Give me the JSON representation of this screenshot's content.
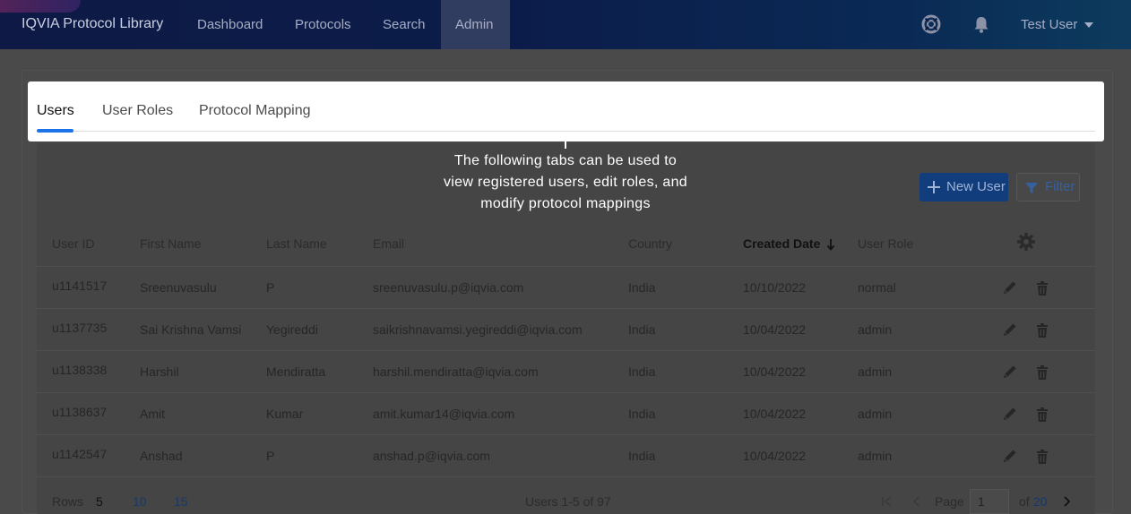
{
  "app": {
    "title": "IQVIA Protocol Library"
  },
  "nav": {
    "items": [
      "Dashboard",
      "Protocols",
      "Search",
      "Admin"
    ],
    "active": "Admin"
  },
  "header": {
    "help_icon": "life-ring-icon",
    "notifications_icon": "bell-icon",
    "user_name": "Test User"
  },
  "tabs": {
    "items": [
      "Users",
      "User Roles",
      "Protocol Mapping"
    ],
    "active": "Users"
  },
  "tooltip": {
    "text": "The following tabs can be used to view registered users, edit roles, and modify protocol mappings"
  },
  "toolbar": {
    "new_user_label": "New User",
    "filter_label": "Filter"
  },
  "table": {
    "columns": [
      "User ID",
      "First Name",
      "Last Name",
      "Email",
      "Country",
      "Created Date",
      "User Role"
    ],
    "sorted_column": "Created Date",
    "sort_direction": "descending",
    "rows": [
      {
        "user_id": "u1141517",
        "first_name": "Sreenuvasulu",
        "last_name": "P",
        "email": "sreenuvasulu.p@iqvia.com",
        "country": "India",
        "created_date": "10/10/2022",
        "user_role": "normal"
      },
      {
        "user_id": "u1137735",
        "first_name": "Sai Krishna Vamsi",
        "last_name": "Yegireddi",
        "email": "saikrishnavamsi.yegireddi@iqvia.com",
        "country": "India",
        "created_date": "10/04/2022",
        "user_role": "admin"
      },
      {
        "user_id": "u1138338",
        "first_name": "Harshil",
        "last_name": "Mendiratta",
        "email": "harshil.mendiratta@iqvia.com",
        "country": "India",
        "created_date": "10/04/2022",
        "user_role": "admin"
      },
      {
        "user_id": "u1138637",
        "first_name": "Amit",
        "last_name": "Kumar",
        "email": "amit.kumar14@iqvia.com",
        "country": "India",
        "created_date": "10/04/2022",
        "user_role": "admin"
      },
      {
        "user_id": "u1142547",
        "first_name": "Anshad",
        "last_name": "P",
        "email": "anshad.p@iqvia.com",
        "country": "India",
        "created_date": "10/04/2022",
        "user_role": "admin"
      }
    ]
  },
  "footer": {
    "rows_label": "Rows",
    "rows_options": [
      "5",
      "10",
      "15"
    ],
    "rows_selected": "5",
    "summary": "Users 1-5 of 97",
    "page_label": "Page",
    "page_value": "1",
    "of_label": "of",
    "total_pages": "20"
  },
  "colors": {
    "accent": "#1a73e8",
    "nav_bg": "#0e1a45",
    "button_primary": "#123d7d",
    "overlay": "#4a4a4a"
  }
}
